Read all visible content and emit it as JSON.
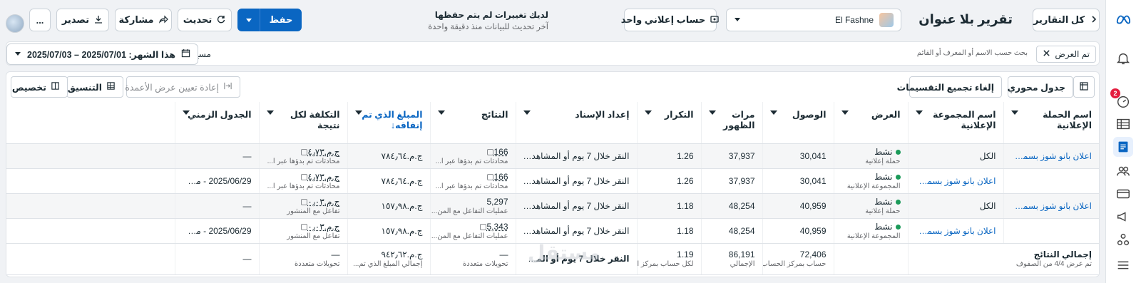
{
  "topbar": {
    "back_label": "كل التقارير",
    "title": "تقرير بلا عنوان",
    "account_name": "El Fashne",
    "single_account_label": "حساب إعلاني واحد",
    "unsaved_line1": "لديك تغييرات لم يتم حفظها",
    "unsaved_line2": "آخر تحديث للبيانات منذ دقيقة واحدة",
    "save_label": "حفظ",
    "refresh_label": "تحديث",
    "share_label": "مشاركة",
    "export_label": "تصدير",
    "more_label": "..."
  },
  "filters": {
    "applied_chip": "تم العرض",
    "search_placeholder": "بحث حسب الاسم أو المعرف أو القائم",
    "clear_label": "مسح",
    "date_range": "هذا الشهر: 2025/07/01 – 2025/07/03"
  },
  "table_toolbar": {
    "customize_label": "تخصيص",
    "format_label": "التنسيق",
    "reset_columns_label": "إعادة تعيين عرض الأعمدة",
    "pivot_label": "جدول محوري",
    "ungroup_label": "إلغاء تجميع التقسيمات"
  },
  "columns": [
    "اسم الحملة الإعلانية",
    "اسم المجموعة الإعلانية",
    "العرض",
    "الوصول",
    "مرات الظهور",
    "التكرار",
    "إعداد الإسناد",
    "النتائج",
    "المبلغ الذي تم إنفاقه",
    "التكلفة لكل نتيجة",
    "الجدول الزمني"
  ],
  "rows": [
    {
      "campaign": "اعلان بانو شوز بسمة م...",
      "adset": "الكل",
      "status": "نشط",
      "status_sub": "حملة إعلانية",
      "reach": "30,041",
      "impressions": "37,937",
      "frequency": "1.26",
      "attribution": "النقر خلال 7 يوم أو المشاهدة...",
      "results": "166",
      "results_sub": "محادثات تم بدؤها عبر ا...",
      "spent": "ج.م.٧٨٤٫٦٤",
      "cost": "ج.م.٤٫٧٣",
      "cost_sub": "محادثات تم بدؤها عبر ا...",
      "schedule": "—"
    },
    {
      "campaign": "",
      "adset": "اعلان بانو شوز بسمة ...",
      "status": "نشط",
      "status_sub": "المجموعة الإعلانية",
      "reach": "30,041",
      "impressions": "37,937",
      "frequency": "1.26",
      "attribution": "النقر خلال 7 يوم أو المشاهدة...",
      "results": "166",
      "results_sub": "محادثات تم بدؤها عبر ا...",
      "spent": "ج.م.٧٨٤٫٦٤",
      "cost": "ج.م.٤٫٧٣",
      "cost_sub": "محادثات تم بدؤها عبر ا...",
      "schedule": "2025/06/29 - مست..."
    },
    {
      "campaign": "اعلان بانو شوز بسمة ت...",
      "adset": "الكل",
      "status": "نشط",
      "status_sub": "حملة إعلانية",
      "reach": "40,959",
      "impressions": "48,254",
      "frequency": "1.18",
      "attribution": "النقر خلال 7 يوم أو المشاهدة...",
      "results": "5,297",
      "results_sub": "عمليات التفاعل مع المن...",
      "spent": "ج.م.١٥٧٫٩٨",
      "cost": "ج.م.٠٫٠٣",
      "cost_sub": "تفاعل مع المنشور",
      "schedule": "—"
    },
    {
      "campaign": "اعلان بانو شوز بسمة ت...",
      "adset": "",
      "status": "نشط",
      "status_sub": "المجموعة الإعلانية",
      "reach": "40,959",
      "impressions": "48,254",
      "frequency": "1.18",
      "attribution": "النقر خلال 7 يوم أو المشاهدة...",
      "results": "5,343",
      "results_sub": "عمليات التفاعل مع المن...",
      "spent": "ج.م.١٥٧٫٩٨",
      "cost": "ج.م.٠٫٠٣",
      "cost_sub": "تفاعل مع المنشور",
      "schedule": "2025/06/29 - مست..."
    }
  ],
  "totals": {
    "label": "إجمالي النتائج",
    "sub": "تم عرض 4/4 من الصفوف",
    "reach": "72,406",
    "reach_sub": "حساب بمركز الحساب...",
    "impressions": "86,191",
    "impressions_sub": "الإجمالي",
    "frequency": "1.19",
    "frequency_sub": "لكل حساب بمركز الحسا...",
    "attribution": "النقر خلال 7 يوم أو المشاهدة...",
    "results": "—",
    "results_sub": "تحويلات متعددة",
    "spent": "ج.م.٩٤٢٫٦٢",
    "spent_sub": "إجمالي المبلغ الذي تم...",
    "cost": "—",
    "cost_sub": "تحويلات متعددة",
    "schedule": "—"
  },
  "watermark": "مستقل"
}
